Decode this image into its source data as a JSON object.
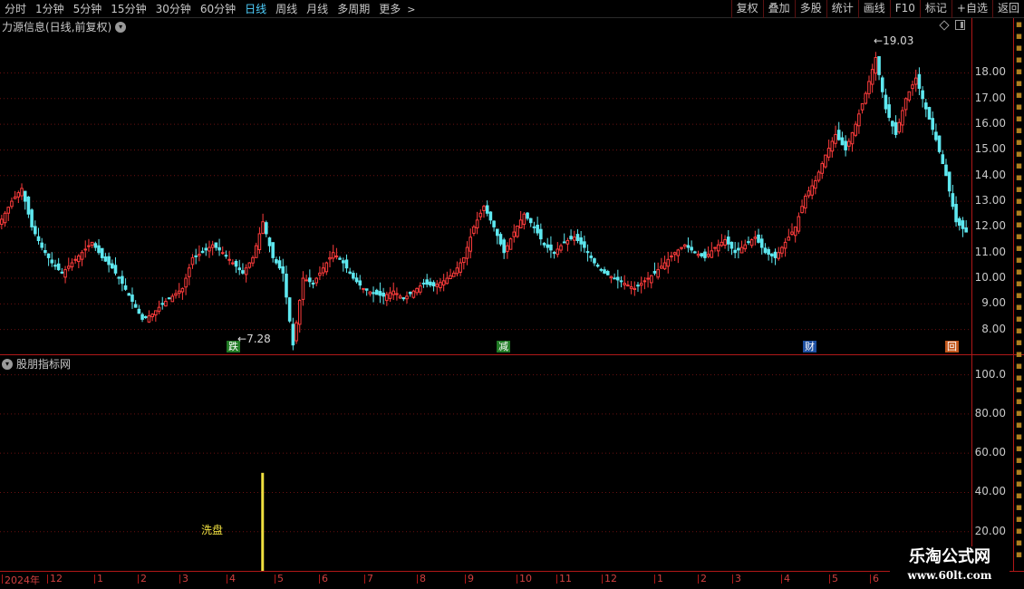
{
  "toolbar": {
    "periods": [
      "分时",
      "1分钟",
      "5分钟",
      "15分钟",
      "30分钟",
      "60分钟",
      "日线",
      "周线",
      "月线",
      "多周期",
      "更多"
    ],
    "active_period": "日线",
    "tools": [
      "复权",
      "叠加",
      "多股",
      "统计",
      "画线",
      "F10",
      "标记",
      "+自选",
      "返回"
    ]
  },
  "main_chart": {
    "title": "力源信息(日线,前复权)",
    "price_labels": [
      "18.00",
      "17.00",
      "16.00",
      "15.00",
      "14.00",
      "13.00",
      "12.00",
      "11.00",
      "10.00",
      "9.00",
      "8.00"
    ],
    "high_label": "19.03",
    "low_label": "7.28",
    "events": [
      {
        "label": "跌",
        "style": "green"
      },
      {
        "label": "减",
        "style": "green"
      },
      {
        "label": "财",
        "style": "blue"
      },
      {
        "label": "回",
        "style": "orange"
      }
    ]
  },
  "indicator": {
    "title": "股朋指标网",
    "labels": [
      "100.0",
      "80.00",
      "60.00",
      "40.00",
      "20.00"
    ],
    "signal_text": "洗盘"
  },
  "xaxis": {
    "labels": [
      "2024年",
      "12",
      "1",
      "2",
      "3",
      "4",
      "5",
      "6",
      "7",
      "8",
      "9",
      "10",
      "11",
      "12",
      "1",
      "2",
      "3",
      "4",
      "5",
      "6"
    ]
  },
  "watermark": {
    "title": "乐淘公式网",
    "url": "www.60lt.com"
  },
  "colors": {
    "up": "#ff3c3c",
    "down": "#5ee8f0",
    "grid": "#6a1010",
    "signal": "#f0e040",
    "active_tab": "#4fd1ff"
  },
  "chart_data": {
    "type": "candlestick",
    "series": [
      {
        "values": [
          12.3,
          13.0,
          13.5,
          12.0,
          11.2,
          10.6,
          10.2,
          10.6,
          11.0,
          11.4,
          10.8,
          10.4,
          9.8,
          9.1,
          8.4,
          8.6,
          9.0,
          9.3,
          9.6,
          10.8,
          11.0,
          11.3,
          11.0,
          10.6,
          10.2,
          10.8,
          12.2,
          10.8,
          10.2,
          7.4,
          10.0,
          9.8,
          10.4,
          11.0,
          10.6,
          10.0,
          9.6,
          9.4,
          9.3,
          9.5,
          9.2,
          9.5,
          9.8,
          9.7,
          9.9,
          10.2,
          10.8,
          12.0,
          12.8,
          12.0,
          11.0,
          11.8,
          12.5,
          12.0,
          11.3,
          11.0,
          11.4,
          11.6,
          11.2,
          10.6,
          10.2,
          10.0,
          9.8,
          9.6,
          9.9,
          10.2,
          10.6,
          11.0,
          11.3,
          11.0,
          10.8,
          11.2,
          11.5,
          11.0,
          11.3,
          11.6,
          11.0,
          10.8,
          11.4,
          12.0,
          13.2,
          13.8,
          14.8,
          15.6,
          15.0,
          16.0,
          17.2,
          18.6,
          16.6,
          15.6,
          17.0,
          17.8,
          16.6,
          15.4,
          14.0,
          12.2,
          11.8
        ]
      },
      {
        "name": "",
        "values": [
          0,
          0,
          0,
          0,
          0,
          0,
          0,
          0,
          0,
          0,
          0,
          0,
          0,
          0,
          0,
          0,
          0,
          0,
          0,
          0,
          0,
          0,
          0,
          0,
          0,
          0,
          0,
          0,
          0,
          0,
          0,
          0,
          0,
          0,
          0,
          0,
          0,
          0,
          0,
          0,
          0,
          0,
          0,
          0,
          0,
          0,
          0,
          0,
          0,
          0,
          0,
          0,
          0,
          0,
          0,
          0,
          0,
          0,
          0,
          0,
          0,
          0,
          0,
          0,
          0,
          0,
          0,
          0,
          0,
          0,
          0,
          0,
          0,
          0,
          0,
          0,
          0,
          0,
          0,
          0,
          0,
          0,
          0,
          0,
          0,
          0,
          0,
          0,
          0,
          0,
          0,
          0,
          0,
          0,
          0,
          0,
          0
        ]
      }
    ],
    "ylim": [
      7.0,
      19.5
    ],
    "indicator_ylim": [
      0,
      110
    ],
    "signal": {
      "index": 26,
      "value": 50
    }
  }
}
